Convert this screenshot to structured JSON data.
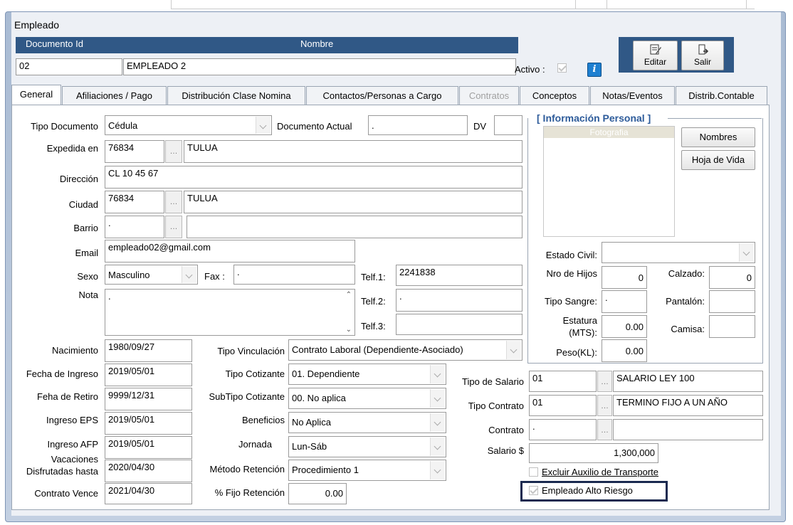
{
  "window_title": "Empleado",
  "header": {
    "documento_label": "Documento Id",
    "nombre_label": "Nombre",
    "documento_value": "02",
    "nombre_value": "EMPLEADO 2",
    "activo_label": "Activo :"
  },
  "toolbar": {
    "editar": "Editar",
    "salir": "Salir"
  },
  "tabs": [
    "General",
    "Afiliaciones / Pago",
    "Distribución Clase Nomina",
    "Contactos/Personas a Cargo",
    "Contratos",
    "Conceptos",
    "Notas/Eventos",
    "Distrib.Contable"
  ],
  "form": {
    "tipo_documento": {
      "label": "Tipo Documento",
      "value": "Cédula"
    },
    "documento_actual": {
      "label": "Documento Actual",
      "value": "."
    },
    "dv": {
      "label": "DV",
      "value": ""
    },
    "expedida_en": {
      "label": "Expedida en",
      "code": "76834",
      "name": "TULUA"
    },
    "direccion": {
      "label": "Dirección",
      "value": "CL 10 45 67"
    },
    "ciudad": {
      "label": "Ciudad",
      "code": "76834",
      "name": "TULUA"
    },
    "barrio": {
      "label": "Barrio",
      "code": ".",
      "name": ""
    },
    "email": {
      "label": "Email",
      "value": "empleado02@gmail.com"
    },
    "sexo": {
      "label": "Sexo",
      "value": "Masculino"
    },
    "fax": {
      "label": "Fax :",
      "value": "."
    },
    "telf1": {
      "label": "Telf.1:",
      "value": "2241838"
    },
    "telf2": {
      "label": "Telf.2:",
      "value": "."
    },
    "telf3": {
      "label": "Telf.3:",
      "value": ""
    },
    "nota": {
      "label": "Nota",
      "value": "."
    },
    "nacimiento": {
      "label": "Nacimiento",
      "value": "1980/09/27"
    },
    "fecha_ingreso": {
      "label": "Fecha de Ingreso",
      "value": "2019/05/01"
    },
    "fecha_retiro": {
      "label": "Feha de Retiro",
      "value": "9999/12/31"
    },
    "ingreso_eps": {
      "label": "Ingreso EPS",
      "value": "2019/05/01"
    },
    "ingreso_afp": {
      "label": "Ingreso AFP",
      "value": "2019/05/01"
    },
    "vacaciones": {
      "label1": "Vacaciones",
      "label2": "Disfrutadas hasta",
      "value": "2020/04/30"
    },
    "contrato_vence": {
      "label": "Contrato Vence",
      "value": "2021/04/30"
    },
    "tipo_vinculacion": {
      "label": "Tipo Vinculación",
      "value": "Contrato Laboral (Dependiente-Asociado)"
    },
    "tipo_cotizante": {
      "label": "Tipo Cotizante",
      "value": "01. Dependiente"
    },
    "subtipo_cotizante": {
      "label": "SubTipo Cotizante",
      "value": "00. No aplica"
    },
    "beneficios": {
      "label": "Beneficios",
      "value": "No Aplica"
    },
    "jornada": {
      "label": "Jornada",
      "value": "Lun-Sáb"
    },
    "metodo_retencion": {
      "label": "Método Retención",
      "value": "Procedimiento 1"
    },
    "fijo_retencion": {
      "label": "% Fijo Retención",
      "value": "0.00"
    },
    "tipo_salario": {
      "label": "Tipo de Salario",
      "code": "01",
      "name": "SALARIO LEY 100"
    },
    "tipo_contrato": {
      "label": "Tipo Contrato",
      "code": "01",
      "name": "TERMINO FIJO A UN AÑO"
    },
    "contrato": {
      "label": "Contrato",
      "code": ".",
      "name": ""
    },
    "salario": {
      "label": "Salario $",
      "value": "1,300,000"
    },
    "excluir_auxilio": {
      "label": "Excluir Auxilio de Transporte"
    },
    "alto_riesgo": {
      "label": "Empleado Alto Riesgo"
    }
  },
  "personal": {
    "title": "[ Información Personal ]",
    "fotografia": "Fotografia",
    "nombres_btn": "Nombres",
    "hoja_vida_btn": "Hoja de Vida",
    "estado_civil": {
      "label": "Estado Civil:",
      "value": ""
    },
    "nro_hijos": {
      "label": "Nro de Hijos",
      "value": "0"
    },
    "calzado": {
      "label": "Calzado:",
      "value": "0"
    },
    "tipo_sangre": {
      "label": "Tipo Sangre:",
      "value": "."
    },
    "pantalon": {
      "label": "Pantalón:",
      "value": ""
    },
    "estatura": {
      "label1": "Estatura",
      "label2": "(MTS):",
      "value": "0.00"
    },
    "camisa": {
      "label": "Camisa:",
      "value": ""
    },
    "peso": {
      "label": "Peso(KL):",
      "value": "0.00"
    }
  }
}
